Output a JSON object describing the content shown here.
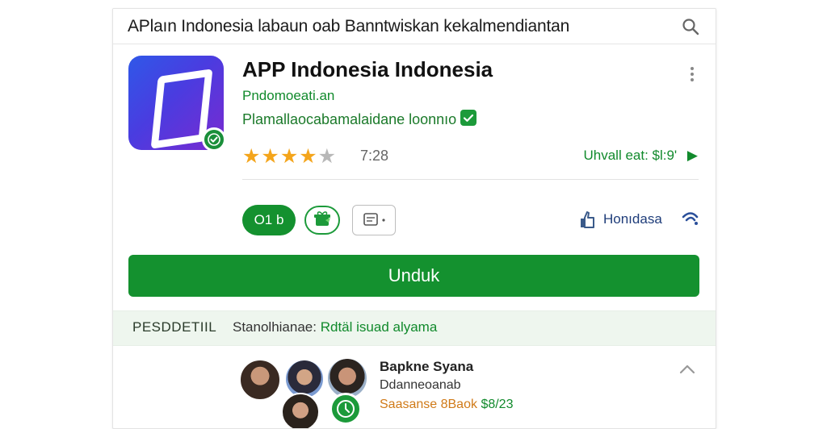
{
  "search": {
    "query": "APlaın Indonesia  labaun oab Banntwiskan kekalmendiantan",
    "icon": "search-icon"
  },
  "app": {
    "title": "APP Indonesia Indonesia",
    "developer": "Pndomoeati.an",
    "tagline": "Plamallaocabamalaidane loonnıo",
    "rating_stars": 4,
    "rating_count": "7:28",
    "price_link": "Uhvall eat: $l:9'",
    "icon_gradient": [
      "#2f58e8",
      "#7a2ad0"
    ],
    "verified_color": "#1a8f3a"
  },
  "actions": {
    "pill_label": "O1 b",
    "share_label": "Honıdasa"
  },
  "install": {
    "label": "Unduk",
    "color": "#14912f"
  },
  "details": {
    "title": "PESDDETIIL",
    "status_label": "Stanolhianae:",
    "status_value": "Rdtäl isuad alyama"
  },
  "review": {
    "name": "Bapkne Syana",
    "subtitle": "Ddanneoanab",
    "price_label": "Saasanse 8Baok",
    "price_value": "$8/23"
  }
}
